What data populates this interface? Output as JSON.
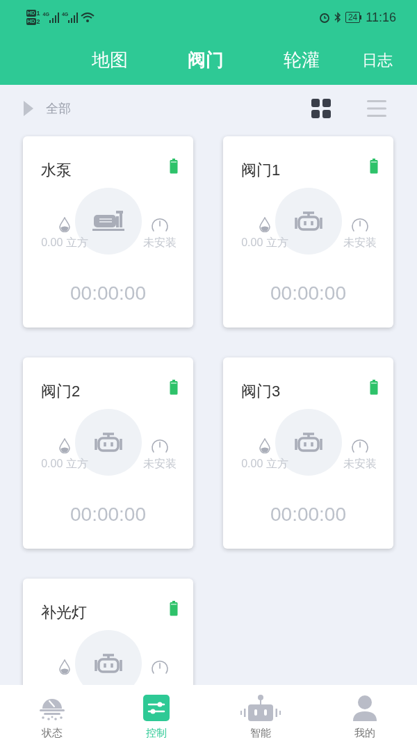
{
  "status_bar": {
    "sims": [
      {
        "badge": "HD",
        "slot": "1",
        "network": "4G"
      },
      {
        "badge": "HD",
        "slot": "2",
        "network": "4G"
      }
    ],
    "battery": "24",
    "time": "11:16"
  },
  "tabs": [
    {
      "label": "地图",
      "selected": false
    },
    {
      "label": "阀门",
      "selected": true
    },
    {
      "label": "轮灌",
      "selected": false
    },
    {
      "label": "日志",
      "selected": false
    }
  ],
  "filter": {
    "label": "全部",
    "views": [
      {
        "kind": "grid",
        "selected": true
      },
      {
        "kind": "list",
        "selected": false
      }
    ]
  },
  "devices": [
    {
      "name": "水泵",
      "kind": "pump",
      "volume": "0.00 立方",
      "meter": "未安装",
      "timer": "00:00:00"
    },
    {
      "name": "阀门1",
      "kind": "valve",
      "volume": "0.00 立方",
      "meter": "未安装",
      "timer": "00:00:00"
    },
    {
      "name": "阀门2",
      "kind": "valve",
      "volume": "0.00 立方",
      "meter": "未安装",
      "timer": "00:00:00"
    },
    {
      "name": "阀门3",
      "kind": "valve",
      "volume": "0.00 立方",
      "meter": "未安装",
      "timer": "00:00:00"
    },
    {
      "name": "补光灯",
      "kind": "valve"
    }
  ],
  "nav": [
    {
      "kind": "status",
      "label": "状态",
      "selected": false
    },
    {
      "kind": "control",
      "label": "控制",
      "selected": true
    },
    {
      "kind": "smart",
      "label": "智能",
      "selected": false
    },
    {
      "kind": "profile",
      "label": "我的",
      "selected": false
    }
  ]
}
